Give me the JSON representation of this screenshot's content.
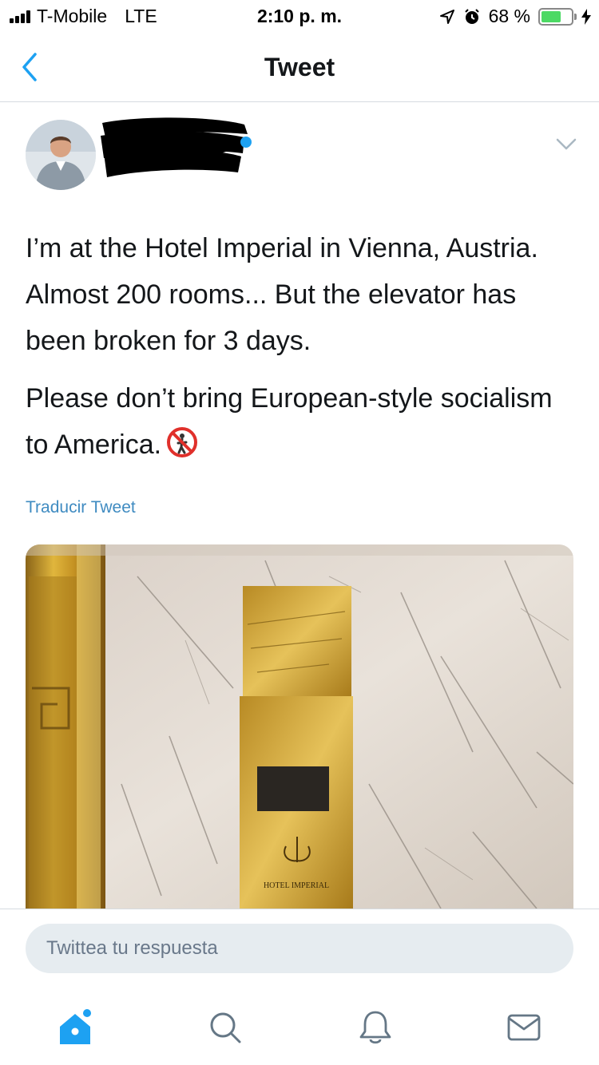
{
  "status_bar": {
    "carrier": "T-Mobile",
    "network": "LTE",
    "time": "2:10 p. m.",
    "battery_percent": "68 %",
    "battery_level": 0.68,
    "icons": [
      "location-arrow-icon",
      "alarm-icon",
      "charging-bolt-icon"
    ]
  },
  "nav": {
    "title": "Tweet",
    "back_icon": "chevron-left-icon"
  },
  "tweet": {
    "paragraphs": [
      "I’m at the Hotel Imperial in Vienna, Austria. Almost 200 rooms... But the elevator has been broken for 3 days.",
      "Please don’t bring European-style socialism to America."
    ],
    "emoji": "no-pedestrians-emoji",
    "translate_label": "Traducir Tweet",
    "media": {
      "sign_text": "HOTEL IMPERIAL"
    }
  },
  "reply": {
    "placeholder": "Twittea tu respuesta"
  },
  "tab_bar": {
    "items": [
      "home-icon",
      "search-icon",
      "notifications-icon",
      "messages-icon"
    ]
  },
  "colors": {
    "accent": "#1da1f2",
    "link": "#3f8bc1",
    "input_bg": "#e6ecf0",
    "battery_fill": "#4cd964"
  }
}
